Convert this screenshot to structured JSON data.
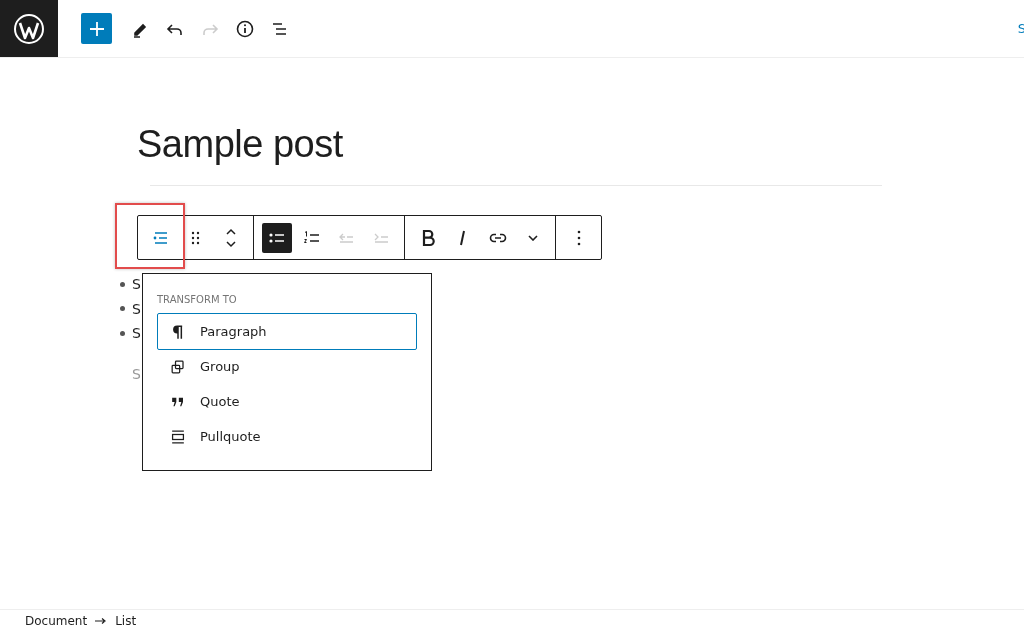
{
  "header": {
    "tools": [
      {
        "kind": "add",
        "selected": true
      },
      {
        "kind": "edit",
        "selected": false
      },
      {
        "kind": "undo",
        "disabled": false
      },
      {
        "kind": "redo",
        "disabled": true
      },
      {
        "kind": "info",
        "selected": false
      },
      {
        "kind": "outline",
        "selected": false
      }
    ],
    "right_text": "S"
  },
  "post": {
    "title": "Sample post"
  },
  "toolbar": {
    "groups": [
      [
        {
          "kind": "transform",
          "selected": true,
          "disabled": false
        },
        {
          "kind": "drag",
          "selected": false,
          "disabled": false
        },
        {
          "kind": "move",
          "selected": false,
          "disabled": false
        }
      ],
      [
        {
          "kind": "bullets",
          "selected": true,
          "disabled": false
        },
        {
          "kind": "numbers",
          "selected": false,
          "disabled": false
        },
        {
          "kind": "outdent",
          "selected": false,
          "disabled": true
        },
        {
          "kind": "indent",
          "selected": false,
          "disabled": true
        }
      ],
      [
        {
          "kind": "bold",
          "selected": false,
          "disabled": false
        },
        {
          "kind": "italic",
          "selected": false,
          "disabled": false
        },
        {
          "kind": "link",
          "selected": false,
          "disabled": false
        },
        {
          "kind": "more-rich",
          "selected": false,
          "disabled": false
        }
      ],
      [
        {
          "kind": "options",
          "selected": false,
          "disabled": false
        }
      ]
    ]
  },
  "list_items": [
    "S",
    "S",
    "S"
  ],
  "placeholder": "S",
  "transform_menu": {
    "heading": "TRANSFORM TO",
    "items": [
      {
        "label": "Paragraph",
        "kind": "paragraph",
        "selected": true
      },
      {
        "label": "Group",
        "kind": "group",
        "selected": false
      },
      {
        "label": "Quote",
        "kind": "quote",
        "selected": false
      },
      {
        "label": "Pullquote",
        "kind": "pullquote",
        "selected": false
      }
    ]
  },
  "breadcrumbs": [
    {
      "label": "Document"
    },
    {
      "label": "List"
    }
  ]
}
